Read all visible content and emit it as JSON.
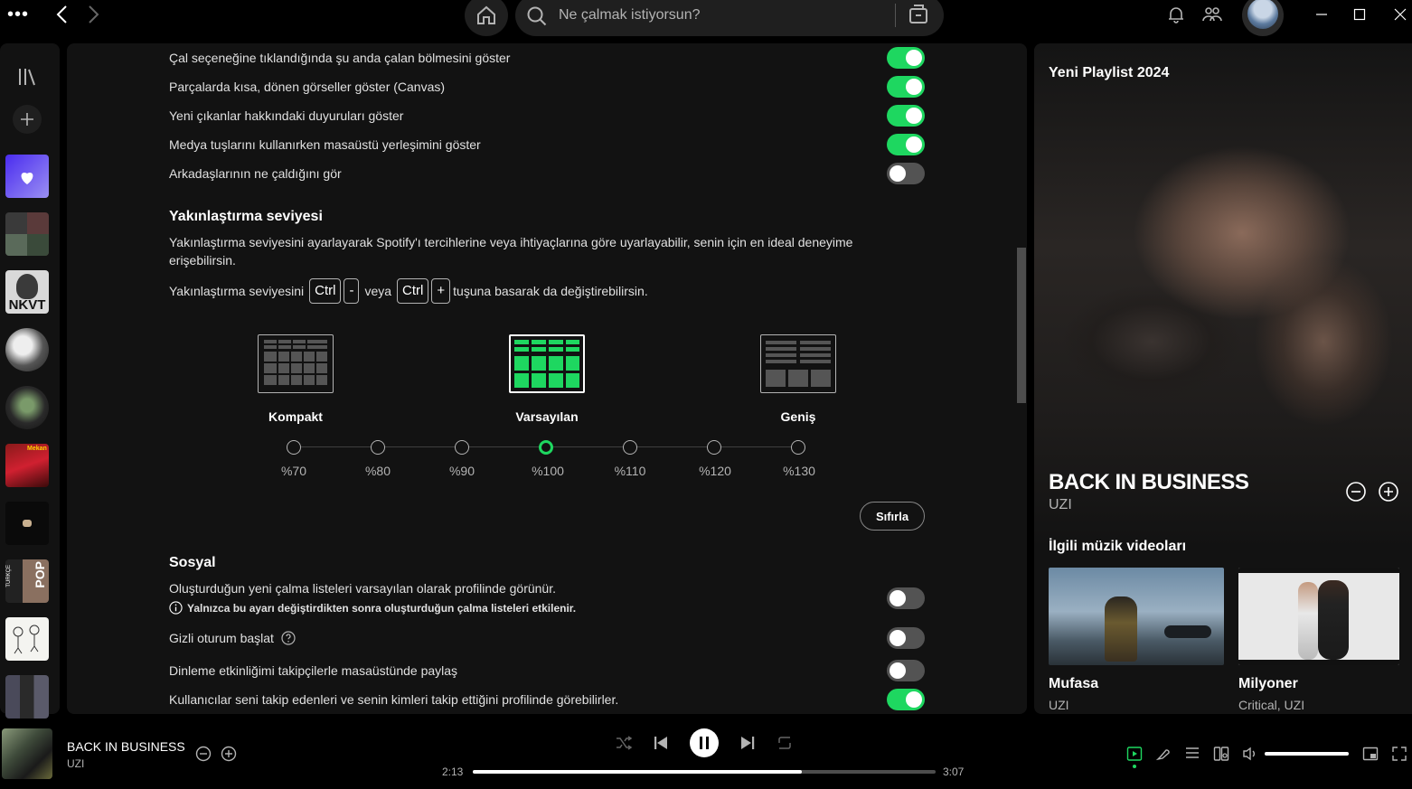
{
  "search": {
    "placeholder": "Ne çalmak istiyorsun?"
  },
  "settings_top": [
    {
      "label": "Çal seçeneğine tıklandığında şu anda çalan bölmesini göster",
      "on": true
    },
    {
      "label": "Parçalarda kısa, dönen görseller göster (Canvas)",
      "on": true
    },
    {
      "label": "Yeni çıkanlar hakkındaki duyuruları göster",
      "on": true
    },
    {
      "label": "Medya tuşlarını kullanırken masaüstü yerleşimini göster",
      "on": true
    },
    {
      "label": "Arkadaşlarının ne çaldığını gör",
      "on": false
    }
  ],
  "zoom": {
    "title": "Yakınlaştırma seviyesi",
    "description": "Yakınlaştırma seviyesini ayarlayarak Spotify'ı tercihlerine veya ihtiyaçlarına göre uyarlayabilir, senin için en ideal deneyime erişebilirsin.",
    "shortcut_prefix": "Yakınlaştırma seviyesini",
    "key_ctrl": "Ctrl",
    "key_minus": "-",
    "key_or": "veya",
    "key_plus": "+",
    "shortcut_suffix": "tuşuna basarak da değiştirebilirsin.",
    "layouts": [
      "Kompakt",
      "Varsayılan",
      "Geniş"
    ],
    "levels": [
      "%70",
      "%80",
      "%90",
      "%100",
      "%110",
      "%120",
      "%130"
    ],
    "selected_level": "%100",
    "reset_label": "Sıfırla"
  },
  "social": {
    "title": "Sosyal",
    "items": [
      {
        "label": "Oluşturduğun yeni çalma listeleri varsayılan olarak profilinde görünür.",
        "note": "Yalnızca bu ayarı değiştirdikten sonra oluşturduğun çalma listeleri etkilenir.",
        "on": false
      },
      {
        "label": "Gizli oturum başlat",
        "on": false
      },
      {
        "label": "Dinleme etkinliğimi takipçilerle masaüstünde paylaş",
        "on": false
      },
      {
        "label": "Kullanıcılar seni takip edenleri ve senin kimleri takip ettiğini profilinde görebilirler.",
        "on": true
      }
    ]
  },
  "now_playing_panel": {
    "playlist": "Yeni Playlist 2024",
    "song": "BACK IN BUSINESS",
    "artist": "UZI",
    "related_title": "İlgili müzik videoları",
    "videos": [
      {
        "title": "Mufasa",
        "artist": "UZI"
      },
      {
        "title": "Milyoner",
        "artist": "Critical, UZI"
      }
    ]
  },
  "player": {
    "song": "BACK IN BUSINESS",
    "artist": "UZI",
    "elapsed": "2:13",
    "duration": "3:07",
    "progress": 0.711,
    "volume": 1.0
  },
  "sidebar": {
    "thumb_texts": [
      "NKVT",
      "Mekan",
      "TÜRKÇE",
      "POP"
    ]
  },
  "colors": {
    "accent": "#1ed760",
    "bg": "#121212",
    "base": "#000000"
  }
}
